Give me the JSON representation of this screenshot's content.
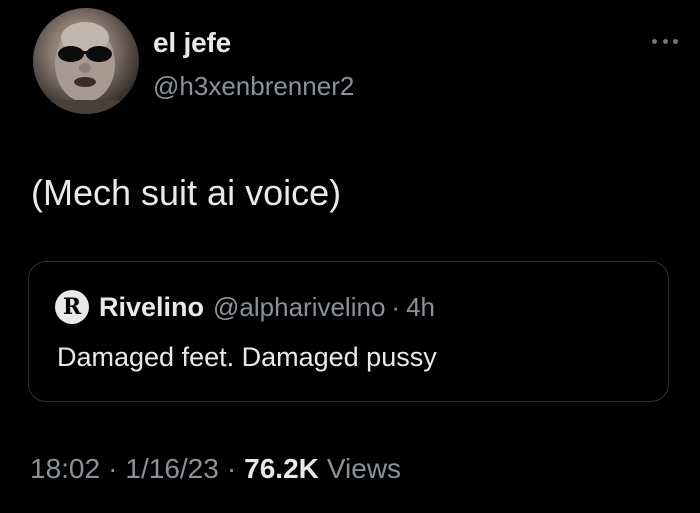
{
  "author": {
    "display_name": "el jefe",
    "handle": "@h3xenbrenner2",
    "avatar_icon": "user-avatar-photo"
  },
  "tweet": {
    "text": "(Mech suit ai voice)"
  },
  "quoted_tweet": {
    "avatar_letter": "R",
    "display_name": "Rivelino",
    "handle": "@alpharivelino",
    "separator": "·",
    "time_ago": "4h",
    "text": "Damaged feet. Damaged pussy"
  },
  "meta": {
    "time": "18:02",
    "separator": "·",
    "date": "1/16/23",
    "views_count": "76.2K",
    "views_label": "Views"
  },
  "colors": {
    "background": "#000000",
    "primary_text": "#e7e9ea",
    "secondary_text": "#8b9197",
    "border": "#2f3336"
  }
}
